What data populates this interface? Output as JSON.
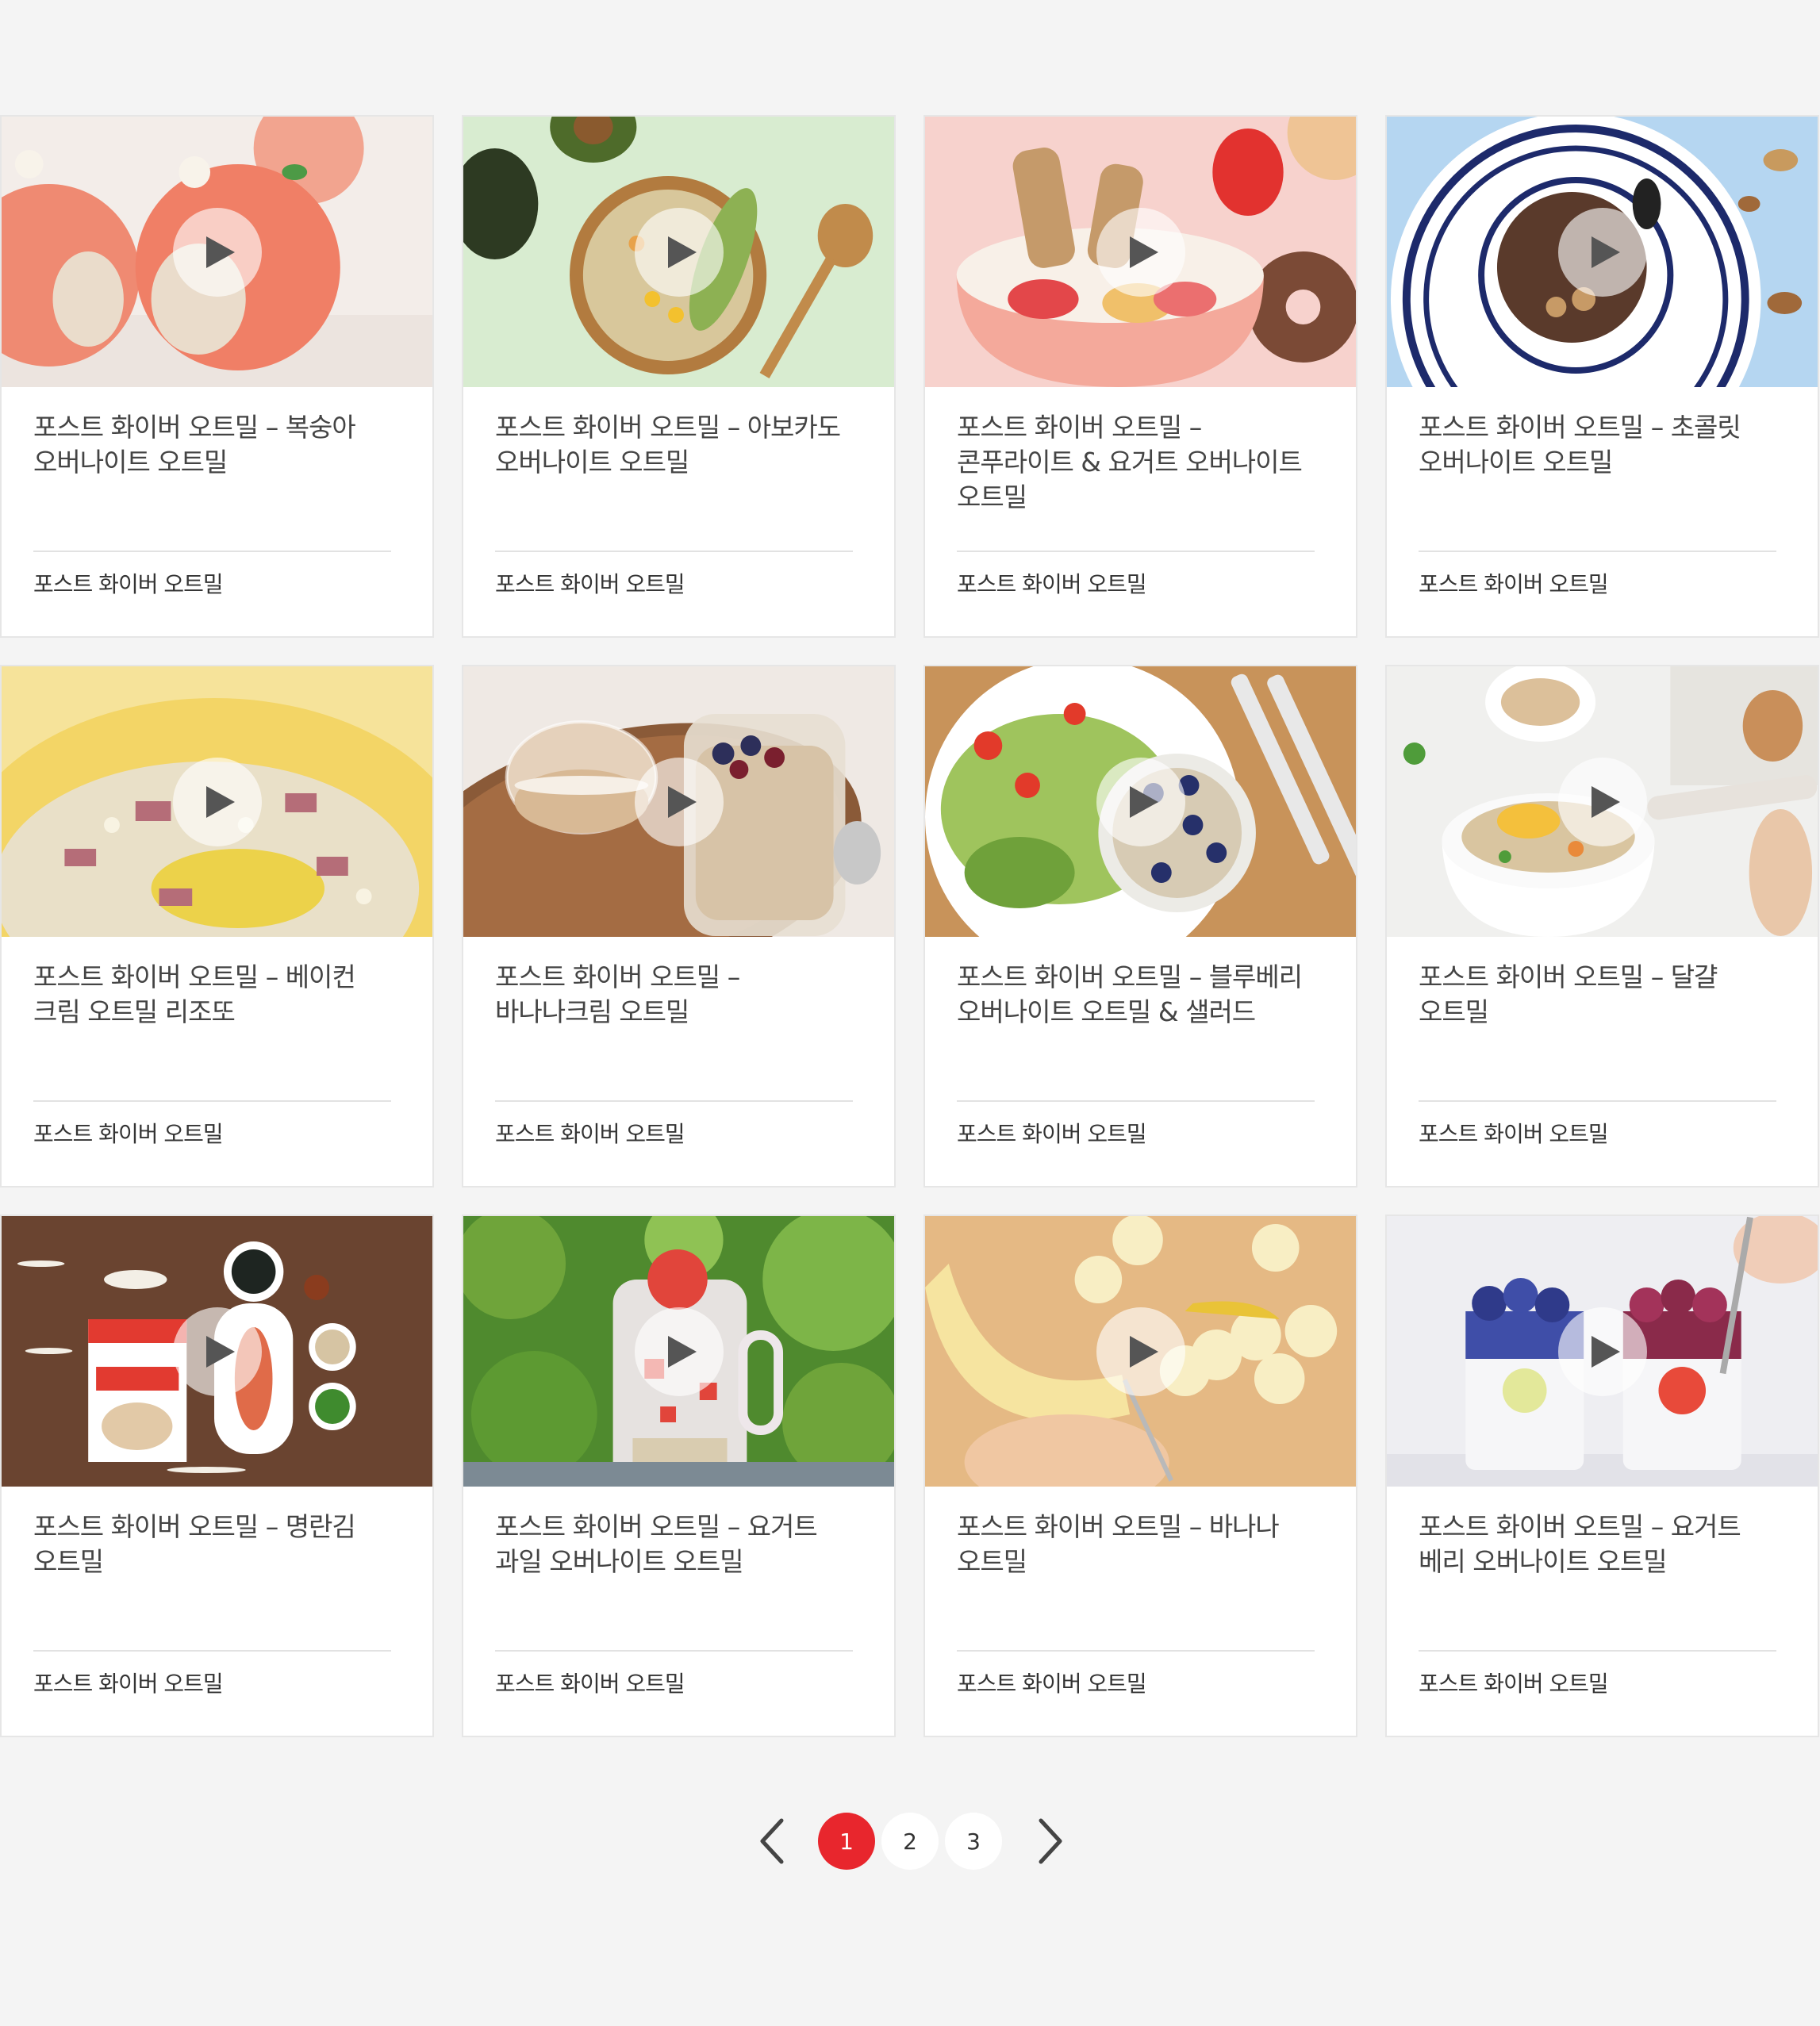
{
  "accent_color": "#e8262d",
  "play_icon": "play-icon",
  "cards": [
    {
      "title": "포스트 화이버 오트밀 – 복숭아 오버나이트 오트밀",
      "category": "포스트 화이버 오트밀"
    },
    {
      "title": "포스트 화이버 오트밀 – 아보카도 오버나이트 오트밀",
      "category": "포스트 화이버 오트밀"
    },
    {
      "title": "포스트 화이버 오트밀 – 콘푸라이트 & 요거트 오버나이트 오트밀",
      "category": "포스트 화이버 오트밀"
    },
    {
      "title": "포스트 화이버 오트밀 – 초콜릿 오버나이트 오트밀",
      "category": "포스트 화이버 오트밀"
    },
    {
      "title": "포스트 화이버 오트밀 – 베이컨 크림 오트밀 리조또",
      "category": "포스트 화이버 오트밀"
    },
    {
      "title": "포스트 화이버 오트밀 – 바나나크림 오트밀",
      "category": "포스트 화이버 오트밀"
    },
    {
      "title": "포스트 화이버 오트밀 – 블루베리 오버나이트 오트밀 & 샐러드",
      "category": "포스트 화이버 오트밀"
    },
    {
      "title": "포스트 화이버 오트밀 – 달걀 오트밀",
      "category": "포스트 화이버 오트밀"
    },
    {
      "title": "포스트 화이버 오트밀 – 명란김 오트밀",
      "category": "포스트 화이버 오트밀"
    },
    {
      "title": "포스트 화이버 오트밀 – 요거트 과일 오버나이트 오트밀",
      "category": "포스트 화이버 오트밀"
    },
    {
      "title": "포스트 화이버 오트밀 – 바나나 오트밀",
      "category": "포스트 화이버 오트밀"
    },
    {
      "title": "포스트 화이버 오트밀 – 요거트 베리 오버나이트 오트밀",
      "category": "포스트 화이버 오트밀"
    }
  ],
  "pagination": {
    "prev_icon": "chevron-left-icon",
    "next_icon": "chevron-right-icon",
    "pages": [
      "1",
      "2",
      "3"
    ],
    "current": "1"
  }
}
